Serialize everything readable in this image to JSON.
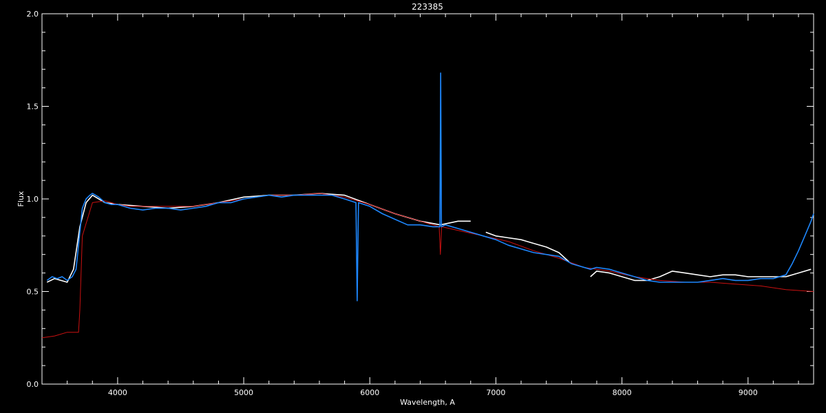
{
  "chart_data": {
    "type": "line",
    "title": "223385",
    "xlabel": "Wavelength, A",
    "ylabel": "Flux",
    "xlim": [
      3400,
      9520
    ],
    "ylim": [
      0.0,
      2.0
    ],
    "x_ticks": [
      {
        "value": 4000,
        "label": "4000"
      },
      {
        "value": 5000,
        "label": "5000"
      },
      {
        "value": 6000,
        "label": "6000"
      },
      {
        "value": 7000,
        "label": "7000"
      },
      {
        "value": 8000,
        "label": "8000"
      },
      {
        "value": 9000,
        "label": "9000"
      }
    ],
    "y_ticks": [
      {
        "value": 0.0,
        "label": "0.0"
      },
      {
        "value": 0.5,
        "label": "0.5"
      },
      {
        "value": 1.0,
        "label": "1.0"
      },
      {
        "value": 1.5,
        "label": "1.5"
      },
      {
        "value": 2.0,
        "label": "2.0"
      }
    ],
    "grid": false,
    "colors": {
      "background": "#000000",
      "axes": "#ffffff",
      "model": "#cc1111",
      "observed_white": "#ffffff",
      "observed_blue": "#1e88ff"
    },
    "series": [
      {
        "color": "#ffffff",
        "x": [
          3440,
          3500,
          3600,
          3650,
          3700,
          3750,
          3800,
          3900,
          4000,
          4200,
          4400,
          4600,
          4800,
          5000,
          5200,
          5400,
          5600,
          5800,
          6000,
          6200,
          6400,
          6560,
          6700,
          6800
        ],
        "y": [
          0.55,
          0.57,
          0.55,
          0.62,
          0.85,
          0.98,
          1.02,
          0.98,
          0.97,
          0.96,
          0.95,
          0.96,
          0.98,
          1.01,
          1.02,
          1.02,
          1.03,
          1.02,
          0.97,
          0.92,
          0.88,
          0.86,
          0.88,
          0.88
        ]
      },
      {
        "color": "#ffffff",
        "x": [
          6920,
          7000,
          7100,
          7200,
          7300,
          7400,
          7500,
          7580
        ],
        "y": [
          0.82,
          0.8,
          0.79,
          0.78,
          0.76,
          0.74,
          0.71,
          0.66
        ]
      },
      {
        "color": "#ffffff",
        "x": [
          7750,
          7800,
          7900,
          8000,
          8100,
          8200,
          8300,
          8400,
          8500,
          8600,
          8700,
          8800,
          8900,
          9000,
          9100,
          9200,
          9300,
          9400,
          9500
        ],
        "y": [
          0.58,
          0.61,
          0.6,
          0.58,
          0.56,
          0.56,
          0.58,
          0.61,
          0.6,
          0.59,
          0.58,
          0.59,
          0.59,
          0.58,
          0.58,
          0.58,
          0.58,
          0.6,
          0.62
        ]
      },
      {
        "color": "#cc1111",
        "x": [
          3400,
          3500,
          3600,
          3690,
          3700,
          3720,
          3800,
          3900,
          4000,
          4100,
          4200,
          4400,
          4600,
          4800,
          5000,
          5200,
          5400,
          5600,
          5800,
          6000,
          6200,
          6400,
          6550,
          6560,
          6570,
          6700,
          6900,
          7100,
          7300,
          7500,
          7700,
          7900,
          8100,
          8300,
          8500,
          8700,
          8900,
          9100,
          9300,
          9520
        ],
        "y": [
          0.25,
          0.26,
          0.28,
          0.28,
          0.4,
          0.8,
          0.98,
          0.99,
          0.97,
          0.96,
          0.96,
          0.96,
          0.96,
          0.98,
          1.0,
          1.02,
          1.02,
          1.03,
          1.01,
          0.97,
          0.92,
          0.88,
          0.85,
          0.7,
          0.85,
          0.83,
          0.8,
          0.77,
          0.72,
          0.68,
          0.63,
          0.61,
          0.58,
          0.56,
          0.55,
          0.55,
          0.54,
          0.53,
          0.51,
          0.5
        ]
      },
      {
        "color": "#1e88ff",
        "x": [
          3440,
          3480,
          3520,
          3560,
          3600,
          3640,
          3670,
          3700,
          3720,
          3750,
          3780,
          3800,
          3850,
          3900,
          3950,
          4000,
          4100,
          4200,
          4300,
          4400,
          4500,
          4600,
          4700,
          4800,
          4900,
          5000,
          5100,
          5200,
          5300,
          5400,
          5500,
          5600,
          5700,
          5800,
          5890,
          5900,
          5910,
          6000,
          6100,
          6200,
          6300,
          6400,
          6500,
          6556,
          6562,
          6568,
          6600,
          6700,
          6800,
          6900,
          7000,
          7100,
          7200,
          7300,
          7400,
          7500,
          7600,
          7750,
          7800,
          7900,
          8000,
          8100,
          8200,
          8300,
          8400,
          8500,
          8600,
          8700,
          8800,
          8900,
          9000,
          9100,
          9200,
          9300,
          9350,
          9400,
          9450,
          9500,
          9520
        ],
        "y": [
          0.56,
          0.58,
          0.57,
          0.58,
          0.56,
          0.58,
          0.62,
          0.82,
          0.95,
          1.0,
          1.02,
          1.03,
          1.01,
          0.98,
          0.97,
          0.97,
          0.95,
          0.94,
          0.95,
          0.95,
          0.94,
          0.95,
          0.96,
          0.98,
          0.98,
          1.0,
          1.01,
          1.02,
          1.01,
          1.02,
          1.02,
          1.02,
          1.02,
          1.0,
          0.98,
          0.45,
          0.98,
          0.96,
          0.92,
          0.89,
          0.86,
          0.86,
          0.85,
          0.85,
          1.68,
          0.85,
          0.86,
          0.84,
          0.82,
          0.8,
          0.78,
          0.75,
          0.73,
          0.71,
          0.7,
          0.69,
          0.65,
          0.62,
          0.63,
          0.62,
          0.6,
          0.58,
          0.56,
          0.55,
          0.55,
          0.55,
          0.55,
          0.56,
          0.57,
          0.56,
          0.56,
          0.57,
          0.57,
          0.59,
          0.65,
          0.72,
          0.8,
          0.88,
          0.92
        ]
      }
    ]
  }
}
